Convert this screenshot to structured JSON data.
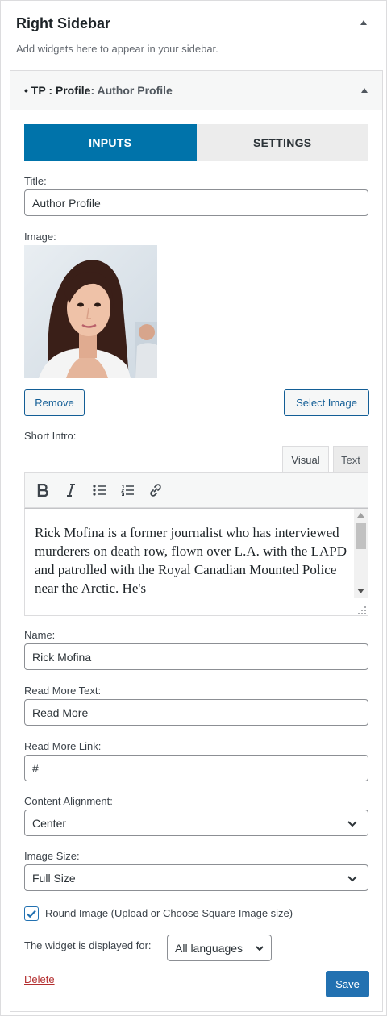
{
  "sidebar": {
    "title": "Right Sidebar",
    "description": "Add widgets here to appear in your sidebar."
  },
  "widget": {
    "title_prefix": "• TP : Profile",
    "title_sep": ":",
    "title_name": "Author Profile",
    "tabs": [
      {
        "label": "INPUTS",
        "active": true
      },
      {
        "label": "SETTINGS",
        "active": false
      }
    ],
    "fields": {
      "title_label": "Title:",
      "title_value": "Author Profile",
      "image_label": "Image:",
      "remove_label": "Remove",
      "select_image_label": "Select Image",
      "intro_label": "Short Intro:",
      "editor_tabs": [
        "Visual",
        "Text"
      ],
      "intro_text": "Rick Mofina is a former journalist who has interviewed murderers on death row, flown over L.A. with the LAPD and patrolled with the Royal Canadian Mounted Police near the Arctic. He's",
      "name_label": "Name:",
      "name_value": "Rick Mofina",
      "read_more_text_label": "Read More Text:",
      "read_more_text_value": "Read More",
      "read_more_link_label": "Read More Link:",
      "read_more_link_value": "#",
      "alignment_label": "Content Alignment:",
      "alignment_value": "Center",
      "image_size_label": "Image Size:",
      "image_size_value": "Full Size",
      "round_image_label": "Round Image (Upload or Choose Square Image size)",
      "round_image_checked": true,
      "displayed_for_label": "The widget is displayed for:",
      "displayed_for_value": "All languages"
    },
    "delete_label": "Delete",
    "save_label": "Save"
  },
  "colors": {
    "accent": "#0073aa",
    "button_primary": "#2271b1",
    "delete_red": "#b32d2e"
  },
  "icons": [
    "bold-icon",
    "italic-icon",
    "bullet-list-icon",
    "numbered-list-icon",
    "link-icon",
    "chevron-down-icon",
    "checkmark-icon"
  ]
}
